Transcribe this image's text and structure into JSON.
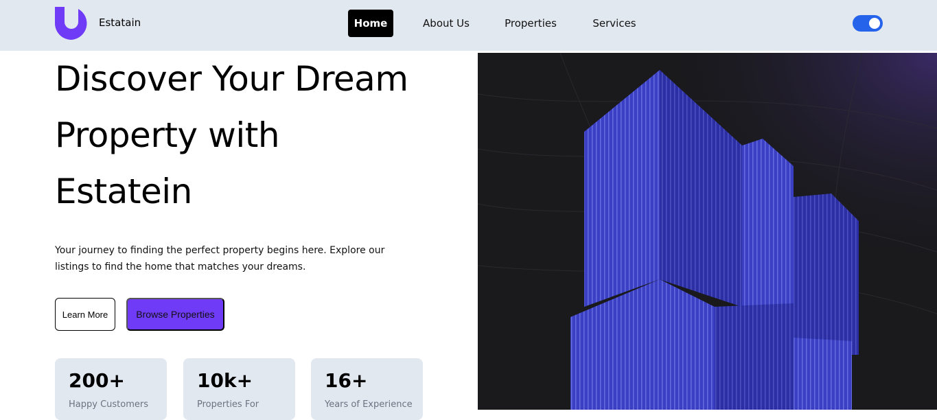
{
  "header": {
    "brand": "Estatain",
    "nav": [
      {
        "label": "Home",
        "active": true
      },
      {
        "label": "About Us",
        "active": false
      },
      {
        "label": "Properties",
        "active": false
      },
      {
        "label": "Services",
        "active": false
      }
    ],
    "theme_toggle": {
      "icon": "toggle-switch-icon",
      "state": "on"
    }
  },
  "hero": {
    "title_lines": [
      "Discover Your Dream",
      "Property with",
      "Estatein"
    ],
    "subtitle_lines": [
      "Your journey to finding the perfect property begins here. Explore our",
      "listings to find the home that matches your dreams."
    ],
    "buttons": {
      "learn_more": "Learn More",
      "browse": "Browse Properties"
    },
    "stats": [
      {
        "value": "200+",
        "label": "Happy Customers"
      },
      {
        "value": "10k+",
        "label": "Properties For"
      },
      {
        "value": "16+",
        "label": "Years of Experience"
      }
    ],
    "image": {
      "subject": "building-image"
    }
  },
  "colors": {
    "accent": "#703bf7",
    "toggle": "#2563eb",
    "header_bg": "#e2e8f0",
    "card_bg": "#e2e8f0",
    "image_bg": "#1a1a1d",
    "building": "#3a3fc4"
  }
}
